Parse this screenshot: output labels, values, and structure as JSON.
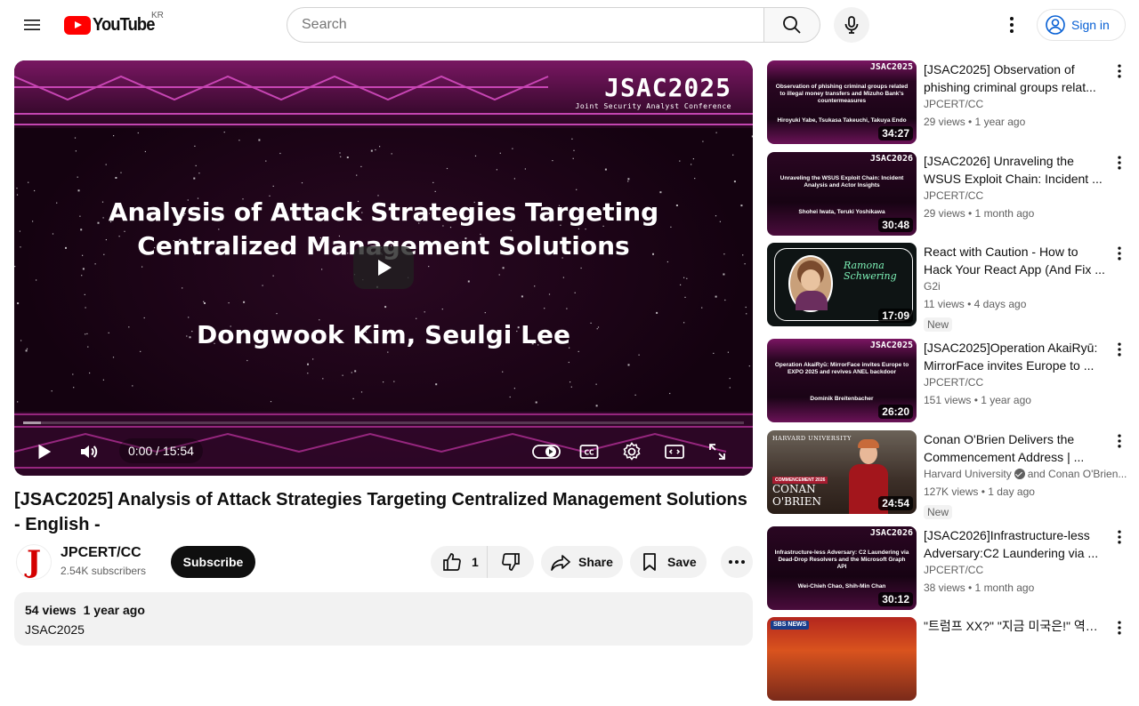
{
  "masthead": {
    "logo_text": "YouTube",
    "region": "KR",
    "search_placeholder": "Search",
    "sign_in": "Sign in"
  },
  "player": {
    "slide_brand": "JSAC2025",
    "slide_brand_sub": "Joint Security Analyst Conference",
    "slide_title_line1": "Analysis of Attack Strategies Targeting",
    "slide_title_line2": "Centralized Management Solutions",
    "slide_authors": "Dongwook Kim, Seulgi Lee",
    "time": "0:00 / 15:54",
    "progress_fraction": 0.0
  },
  "video": {
    "title": "[JSAC2025] Analysis of Attack Strategies Targeting Centralized Management Solutions - English -",
    "channel": "JPCERT/CC",
    "subscribers": "2.54K subscribers",
    "subscribe_label": "Subscribe",
    "likes": "1",
    "share_label": "Share",
    "save_label": "Save",
    "views": "54 views",
    "age": "1 year ago",
    "tag": "JSAC2025"
  },
  "recommendations": [
    {
      "title_l1": "[JSAC2025] Observation of",
      "title_l2": "phishing criminal groups relat...",
      "channel": "JPCERT/CC",
      "meta": "29 views • 1 year ago",
      "duration": "34:27",
      "thumb_brand": "JSAC2025",
      "thumb_title": "Observation of phishing criminal groups related to illegal money transfers and Mizuho Bank's countermeasures",
      "thumb_authors": "Hiroyuki Yabe, Tsukasa Takeuchi, Takuya Endo",
      "theme": "jsac"
    },
    {
      "title_l1": "[JSAC2026] Unraveling the",
      "title_l2": "WSUS Exploit Chain: Incident ...",
      "channel": "JPCERT/CC",
      "meta": "29 views • 1 month ago",
      "duration": "30:48",
      "thumb_brand": "JSAC2026",
      "thumb_title": "Unraveling the WSUS Exploit Chain: Incident Analysis and Actor Insights",
      "thumb_authors": "Shohei Iwata, Teruki Yoshikawa",
      "theme": "jsac26"
    },
    {
      "title_l1": "React with Caution - How to",
      "title_l2": "Hack Your React App (And Fix ...",
      "channel": "G2i",
      "meta": "11 views • 4 days ago",
      "badge": "New",
      "duration": "17:09",
      "thumb_name": "Ramona Schwering",
      "theme": "react"
    },
    {
      "title_l1": "[JSAC2025]Operation AkaiRyū:",
      "title_l2": "MirrorFace invites Europe to ...",
      "channel": "JPCERT/CC",
      "meta": "151 views • 1 year ago",
      "duration": "26:20",
      "thumb_brand": "JSAC2025",
      "thumb_title": "Operation AkaiRyū: MirrorFace invites Europe to EXPO 2025 and revives ANEL backdoor",
      "thumb_authors": "Dominik Breitenbacher",
      "theme": "jsac"
    },
    {
      "title_l1": "Conan O'Brien Delivers the",
      "title_l2": "Commencement Address | ...",
      "channel": "Harvard University",
      "channel_extra": "and Conan O'Brien...",
      "meta": "127K views • 1 day ago",
      "badge": "New",
      "duration": "24:54",
      "thumb_top": "HARVARD UNIVERSITY",
      "thumb_sub": "COMMENCEMENT 2026",
      "thumb_name1": "CONAN",
      "thumb_name2": "O'BRIEN",
      "theme": "harvard"
    },
    {
      "title_l1": "[JSAC2026]Infrastructure-less",
      "title_l2": "Adversary:C2 Laundering via ...",
      "channel": "JPCERT/CC",
      "meta": "38 views • 1 month ago",
      "duration": "30:12",
      "thumb_brand": "JSAC2026",
      "thumb_title": "Infrastructure-less Adversary: C2 Laundering via Dead-Drop Resolvers and the Microsoft Graph API",
      "thumb_authors": "Wei-Chieh Chao, Shih-Min Chan",
      "theme": "jsac26"
    },
    {
      "title_l1": "\"트럼프 XX?\" \"지금 미국은!\" 역대급",
      "title_l2": "",
      "channel": "",
      "meta": "",
      "thumb_top": "SBS NEWS",
      "theme": "sbs"
    }
  ],
  "colors": {
    "brand_red": "#ff0000",
    "link_blue": "#065fd4",
    "jsac_magenta": "#b0218f"
  }
}
